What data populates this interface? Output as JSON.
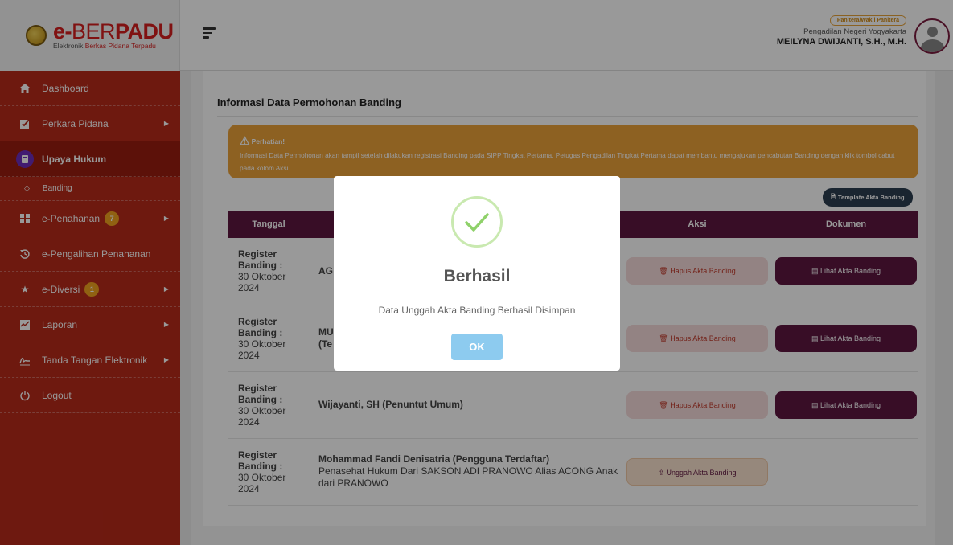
{
  "brand": {
    "name_prefix": "e-",
    "name_thin": "BER",
    "name_bold": "PADU",
    "tagline_1": "Elektronik ",
    "tagline_2": "Berkas Pidana Terpadu"
  },
  "user": {
    "role": "Panitera/Wakil Panitera",
    "court": "Pengadilan Negeri Yogyakarta",
    "name": "MEILYNA DWIJANTI, S.H., M.H."
  },
  "sidebar": {
    "items": [
      {
        "label": "Dashboard",
        "icon": "home-icon"
      },
      {
        "label": "Perkara Pidana",
        "icon": "checkbox-icon"
      },
      {
        "label": "Upaya Hukum",
        "icon": "document-icon"
      },
      {
        "label": "Banding",
        "icon": "dot-icon"
      },
      {
        "label": "e-Penahanan",
        "icon": "grid-icon",
        "badge": "7"
      },
      {
        "label": "e-Pengalihan Penahanan",
        "icon": "history-icon"
      },
      {
        "label": "e-Diversi",
        "icon": "star-icon",
        "badge": "1"
      },
      {
        "label": "Laporan",
        "icon": "chart-icon"
      },
      {
        "label": "Tanda Tangan Elektronik",
        "icon": "signature-icon"
      },
      {
        "label": "Logout",
        "icon": "power-icon"
      }
    ]
  },
  "page": {
    "title": "Informasi Data Permohonan Banding",
    "alert_title": "Perhatian!",
    "alert_msg": "Informasi Data Permohonan akan tampil setelah dilakukan registrasi Banding pada SIPP Tingkat Pertama. Petugas Pengadilan Tingkat Pertama dapat membantu mengajukan pencabutan Banding dengan klik tombol cabut pada kolom Aksi.",
    "template_btn": "Template Akta Banding"
  },
  "table": {
    "headers": [
      "Tanggal",
      "",
      "Aksi",
      "Dokumen"
    ],
    "rows": [
      {
        "date_label": "Register Banding :",
        "date": "30 Oktober 2024",
        "pihak_bold": "AG",
        "pihak_sub": "",
        "aksi": "Hapus Akta Banding",
        "dokumen": "Lihat Akta Banding"
      },
      {
        "date_label": "Register Banding :",
        "date": "30 Oktober 2024",
        "pihak_bold": "MU",
        "pihak_sub": "(Te",
        "aksi": "Hapus Akta Banding",
        "dokumen": "Lihat Akta Banding"
      },
      {
        "date_label": "Register Banding :",
        "date": "30 Oktober 2024",
        "pihak_bold": "Wijayanti, SH (Penuntut Umum)",
        "pihak_sub": "",
        "aksi": "Hapus Akta Banding",
        "dokumen": "Lihat Akta Banding"
      },
      {
        "date_label": "Register Banding :",
        "date": "30 Oktober 2024",
        "pihak_bold": "Mohammad Fandi Denisatria (Pengguna Terdaftar)",
        "pihak_sub": "Penasehat Hukum Dari SAKSON ADI PRANOWO Alias ACONG Anak dari PRANOWO",
        "aksi": "Unggah Akta Banding",
        "dokumen": ""
      }
    ]
  },
  "modal": {
    "title": "Berhasil",
    "message": "Data Unggah Akta Banding Berhasil Disimpan",
    "ok": "OK"
  },
  "colors": {
    "sidebar": "#b82a1a",
    "header_table": "#5e1640",
    "alert": "#eca23a",
    "ok_button": "#8dcbef",
    "success": "#8fd16a"
  }
}
